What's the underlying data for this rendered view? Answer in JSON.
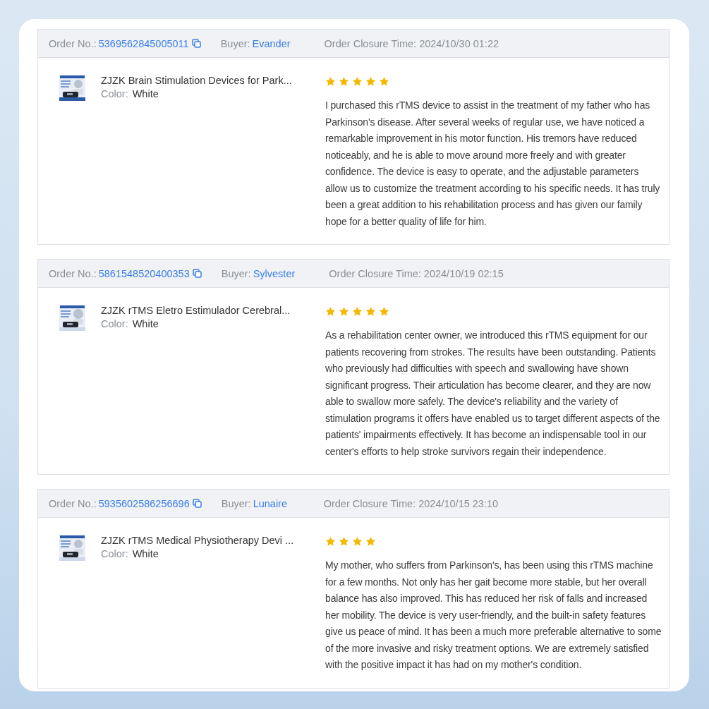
{
  "reviews": [
    {
      "order_label": "Order No.:",
      "order_no": "5369562845005011",
      "buyer_label": "Buyer:",
      "buyer": "Evander",
      "closure": "Order Closure Time: 2024/10/30 01:22",
      "product": {
        "kind": "picture",
        "title": "ZJZK Brain Stimulation Devices for Park...",
        "color_label": "Color:",
        "variant": "White"
      },
      "stars": 5,
      "text": "I purchased this rTMS device to assist in the treatment of my father who has Parkinson's disease. After several weeks of regular use, we have noticed a remarkable improvement in his motor function. His tremors have reduced noticeably, and he is able to move around more freely and with greater confidence. The device is easy to operate, and the adjustable parameters allow us to customize the treatment according to his specific needs. It has truly been a great addition to his rehabilitation process and has given our family hope for a better quality of life for him."
    },
    {
      "order_label": "Order No.:",
      "order_no": "5861548520400353",
      "buyer_label": "Buyer:",
      "buyer": "Sylvester",
      "closure": "Order Closure Time: 2024/10/19 02:15",
      "product": {
        "kind": "picture",
        "title": "ZJZK rTMS Eletro Estimulador Cerebral...",
        "color_label": "Color:",
        "variant": "White"
      },
      "stars": 5,
      "text": "As a rehabilitation center owner, we introduced this rTMS equipment for our patients recovering from strokes. The results have been outstanding. Patients who previously had difficulties with speech and swallowing have shown significant progress. Their articulation has become clearer, and they are now able to swallow more safely. The device's reliability and the variety of stimulation programs it offers have enabled us to target different aspects of the patients' impairments effectively. It has become an indispensable tool in our center's efforts to help stroke survivors regain their independence."
    },
    {
      "order_label": "Order No.:",
      "order_no": "5935602586256696",
      "buyer_label": "Buyer:",
      "buyer": "Lunaire",
      "closure": "Order Closure Time: 2024/10/15 23:10",
      "product": {
        "kind": "picture",
        "title": "ZJZK rTMS Medical Physiotherapy Devi ...",
        "color_label": "Color:",
        "variant": "White"
      },
      "stars": 4,
      "text": "My mother, who suffers from Parkinson's, has been using this rTMS machine for a few months. Not only has her gait become more stable, but her overall balance has also improved. This has reduced her risk of falls and increased her mobility. The device is very user-friendly, and the built-in safety features give us peace of mind. It has been a much more preferable alternative to some of the more invasive and risky treatment options. We are extremely satisfied with the positive impact it has had on my mother's condition."
    }
  ]
}
